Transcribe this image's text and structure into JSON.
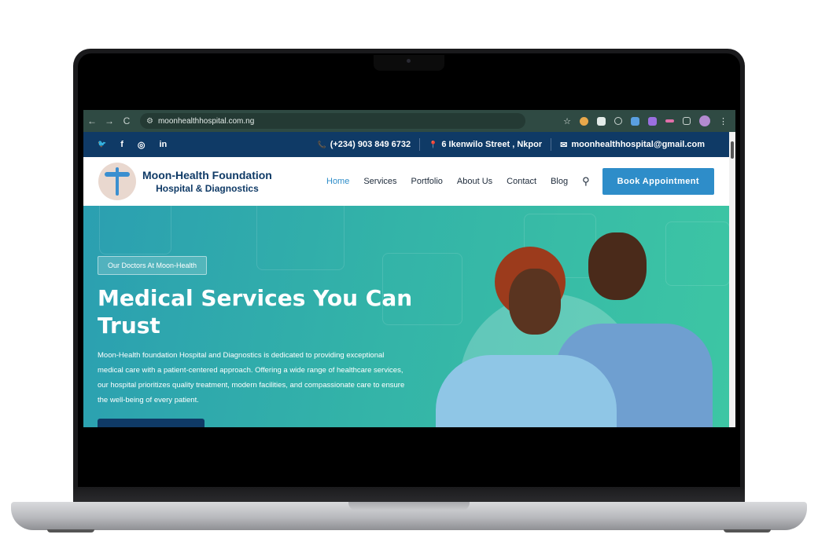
{
  "browser": {
    "url": "moonhealthhospital.com.ng",
    "back_icon": "←",
    "forward_icon": "→",
    "reload_icon": "C",
    "star_icon": "☆",
    "menu_icon": "⋮"
  },
  "topbar": {
    "social": [
      "twitter-icon",
      "facebook-icon",
      "instagram-icon",
      "linkedin-icon"
    ],
    "social_glyphs": [
      "🐦",
      "f",
      "◎",
      "in"
    ],
    "phone_icon": "📞",
    "phone": "(+234) 903 849 6732",
    "location_icon": "📍",
    "address": "6 Ikenwilo Street , Nkpor",
    "mail_icon": "✉",
    "email": "moonhealthhospital@gmail.com"
  },
  "header": {
    "brand_line1": "Moon-Health Foundation",
    "brand_line2": "Hospital & Diagnostics",
    "menu": [
      "Home",
      "Services",
      "Portfolio",
      "About Us",
      "Contact",
      "Blog"
    ],
    "active_item": "Home",
    "search_icon": "🔍",
    "cta": "Book Appointment"
  },
  "hero": {
    "badge": "Our Doctors At Moon-Health",
    "title": "Medical Services You Can Trust",
    "description": "Moon-Health foundation Hospital and Diagnostics is dedicated to providing exceptional medical care with a patient-centered approach. Offering a wide range of healthcare services, our hospital prioritizes quality treatment, modern facilities, and compassionate care to ensure the well-being of every patient."
  },
  "colors": {
    "primary": "#0f3a66",
    "accent": "#2e8dc9",
    "hero_teal": "#33b3a8"
  }
}
